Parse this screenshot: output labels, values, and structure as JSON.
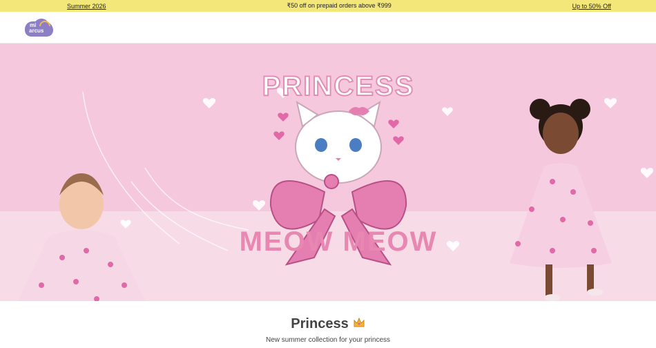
{
  "announcement": {
    "left": "Summer 2026",
    "center": "₹50 off on prepaid orders above ₹999",
    "right": "Up to 50% Off"
  },
  "logo": {
    "line1": "mi",
    "line2": "arcus"
  },
  "hero": {
    "title": "PRINCESS",
    "subtitle": "MEOW MEOW"
  },
  "section": {
    "title": "Princess",
    "icon": "crown-icon",
    "subtitle": "New summer collection for your princess"
  },
  "colors": {
    "announcement_bg": "#f3e77a",
    "hero_bg": "#f6c8dd",
    "accent": "#e887b2"
  }
}
